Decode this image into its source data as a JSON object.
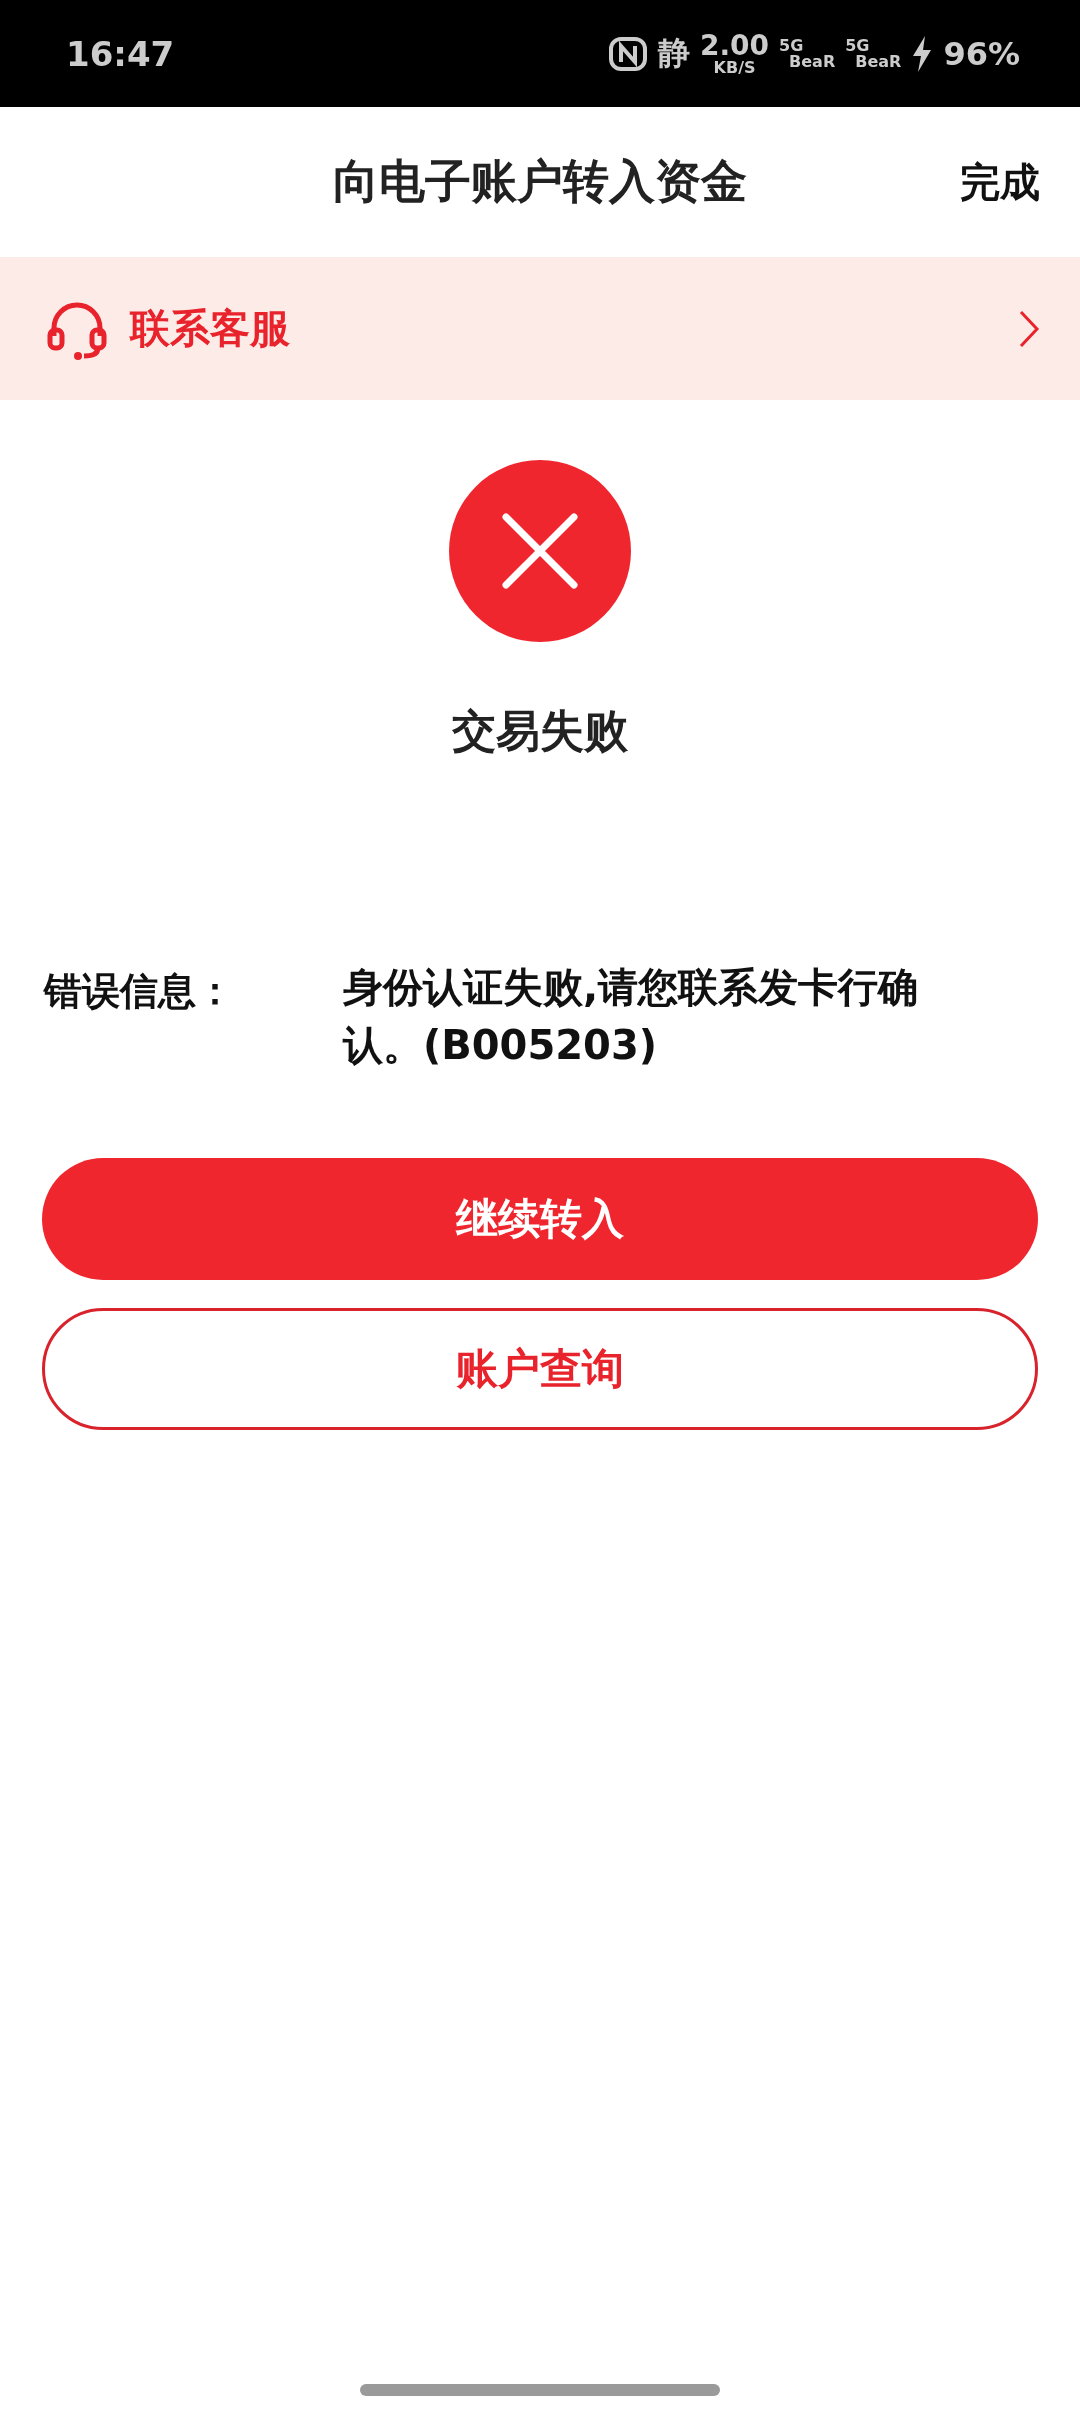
{
  "status_bar": {
    "time": "16:47",
    "mode": "静",
    "speed": "2.00",
    "speed_unit": "KB/S",
    "networks": [
      {
        "type": "5G",
        "carrier": "BeaR"
      },
      {
        "type": "5G",
        "carrier": "BeaR"
      }
    ],
    "battery": "96%"
  },
  "header": {
    "title": "向电子账户转入资金",
    "action": "完成"
  },
  "service_banner": {
    "label": "联系客服"
  },
  "result": {
    "kind": "error",
    "title": "交易失败"
  },
  "error": {
    "label": "错误信息：",
    "message": "身份认证失败,请您联系发卡行确认。(B005203)"
  },
  "buttons": [
    {
      "label": "继续转入",
      "kind": "primary"
    },
    {
      "label": "账户查询",
      "kind": "outline"
    }
  ]
}
